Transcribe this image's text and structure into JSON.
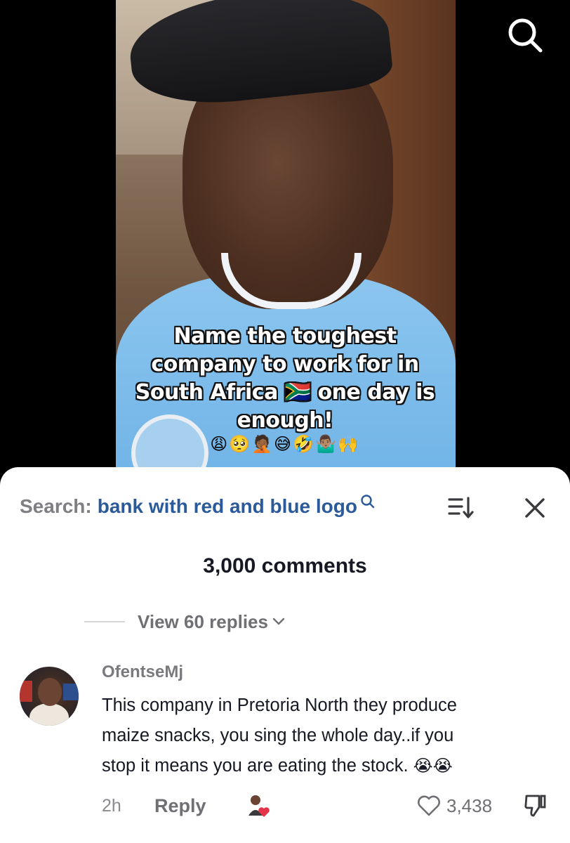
{
  "video": {
    "caption_lines": [
      "Name the toughest",
      "company to work for in",
      "South Africa 🇿🇦 one day is",
      "enough!"
    ],
    "caption_emojis": "😩🥺🤦🏾😅🤣🤷🏽‍♂️🙌",
    "search_icon": "search-icon"
  },
  "search_bar": {
    "prefix": "Search:",
    "query": "bank with red and blue logo",
    "query_icon": "search-icon",
    "sort_icon": "sort-icon",
    "close_icon": "close-icon"
  },
  "comments_header": {
    "count_label": "3,000 comments"
  },
  "replies": {
    "view_label": "View 60 replies"
  },
  "comment": {
    "username": "OfentseMj",
    "lines": [
      "This company in Pretoria North they produce",
      "maize snacks, you sing the whole day..if you",
      "stop it means you are eating the stock."
    ],
    "emojis": "😭😭",
    "time": "2h",
    "reply_label": "Reply",
    "like_count": "3,438",
    "like_icon": "heart-icon",
    "dislike_icon": "thumbs-down-icon"
  },
  "colors": {
    "search_query": "#2b5a9a",
    "sheet_bg": "#ffffff",
    "text_primary": "#161823",
    "text_secondary": "#6f6f74"
  }
}
